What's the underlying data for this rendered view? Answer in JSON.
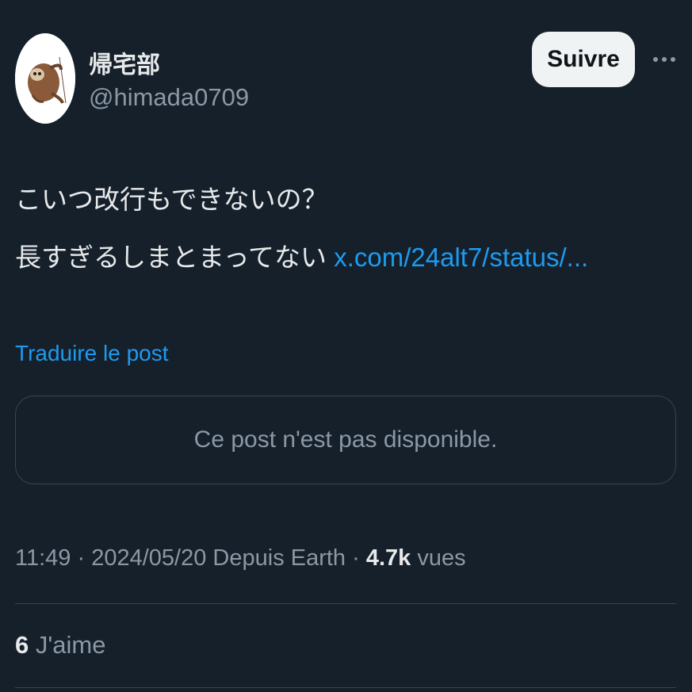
{
  "author": {
    "display_name": "帰宅部",
    "handle": "@himada0709",
    "avatar_icon": "sloth-avatar-icon"
  },
  "actions": {
    "follow_label": "Suivre",
    "more_icon": "more-options-icon"
  },
  "tweet": {
    "line1": "こいつ改行もできないの？",
    "line2_text": "長すぎるしまとまってない ",
    "link_text": "x.com/24alt7/status/..."
  },
  "translate_label": "Traduire le post",
  "quote": {
    "unavailable_text": "Ce post n'est pas disponible."
  },
  "meta": {
    "time": "11:49",
    "separator": " · ",
    "date": "2024/05/20",
    "source": " Depuis Earth",
    "views_count": "4.7k",
    "views_label": " vues"
  },
  "engagement": {
    "likes_count": "6",
    "likes_label": " J'aime"
  },
  "colors": {
    "background": "#15202b",
    "link": "#1d9bf0",
    "secondary_text": "#8b98a5",
    "primary_text": "#e7e9ea",
    "follow_button_bg": "#eff3f4"
  }
}
